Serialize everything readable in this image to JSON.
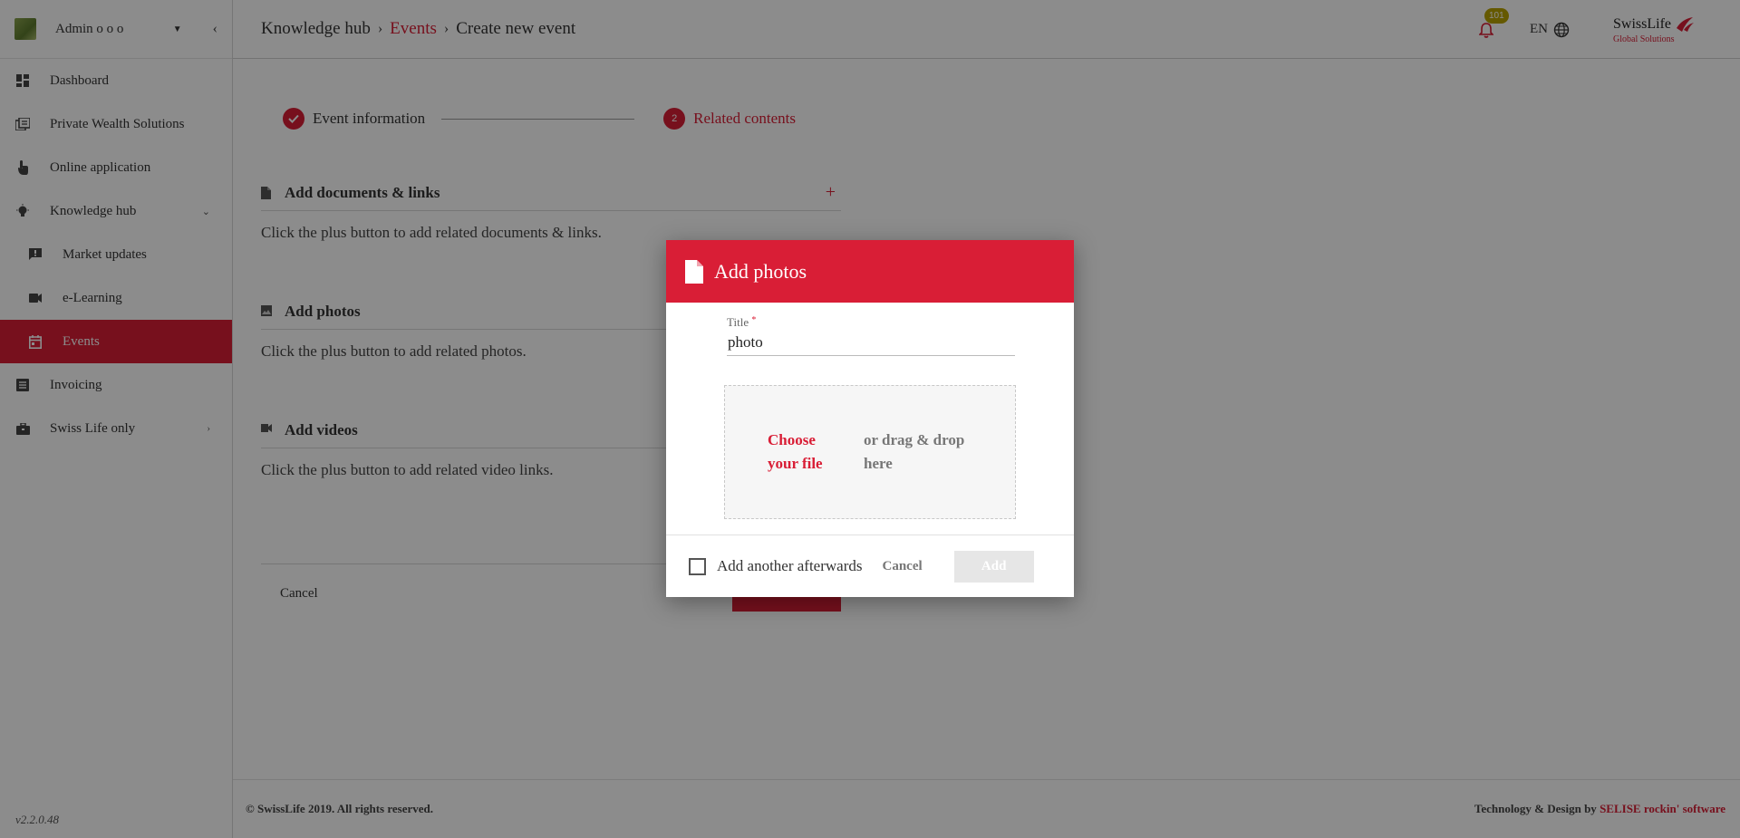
{
  "sidebar": {
    "user": "Admin o o o",
    "items": [
      {
        "label": "Dashboard",
        "icon": "dashboard-icon"
      },
      {
        "label": "Private Wealth Solutions",
        "icon": "library-icon"
      },
      {
        "label": "Online application",
        "icon": "touch-icon"
      },
      {
        "label": "Knowledge hub",
        "icon": "lightbulb-icon"
      },
      {
        "label": "Market updates",
        "icon": "feedback-icon"
      },
      {
        "label": "e-Learning",
        "icon": "videocam-icon"
      },
      {
        "label": "Events",
        "icon": "calendar-icon"
      },
      {
        "label": "Invoicing",
        "icon": "list-icon"
      },
      {
        "label": "Swiss Life only",
        "icon": "briefcase-icon"
      }
    ],
    "version": "v2.2.0.48"
  },
  "header": {
    "breadcrumb": [
      "Knowledge hub",
      "Events",
      "Create new event"
    ],
    "notifications": "101",
    "lang": "EN",
    "brand": "SwissLife",
    "brand_sub": "Global Solutions"
  },
  "stepper": {
    "step1": "Event information",
    "step2_num": "2",
    "step2": "Related contents"
  },
  "sections": {
    "docs_title": "Add documents & links",
    "docs_desc": "Click the plus button to add related documents & links.",
    "photos_title": "Add photos",
    "photos_desc": "Click the plus button to add related photos.",
    "videos_title": "Add videos",
    "videos_desc": "Click the plus button to add related video links.",
    "plus": "+"
  },
  "actions": {
    "cancel": "Cancel"
  },
  "footer": {
    "copyright": "© SwissLife 2019. All rights reserved.",
    "credit_prefix": "Technology & Design by ",
    "credit_link": "SELISE rockin' software"
  },
  "modal": {
    "title": "Add photos",
    "field_label": "Title",
    "field_required": "*",
    "field_value": "photo",
    "choose": "Choose your file",
    "drag": "or drag & drop here",
    "checkbox_label": "Add another afterwards",
    "cancel": "Cancel",
    "add": "Add"
  },
  "colors": {
    "accent": "#d91e36",
    "badge": "#b8a200"
  }
}
